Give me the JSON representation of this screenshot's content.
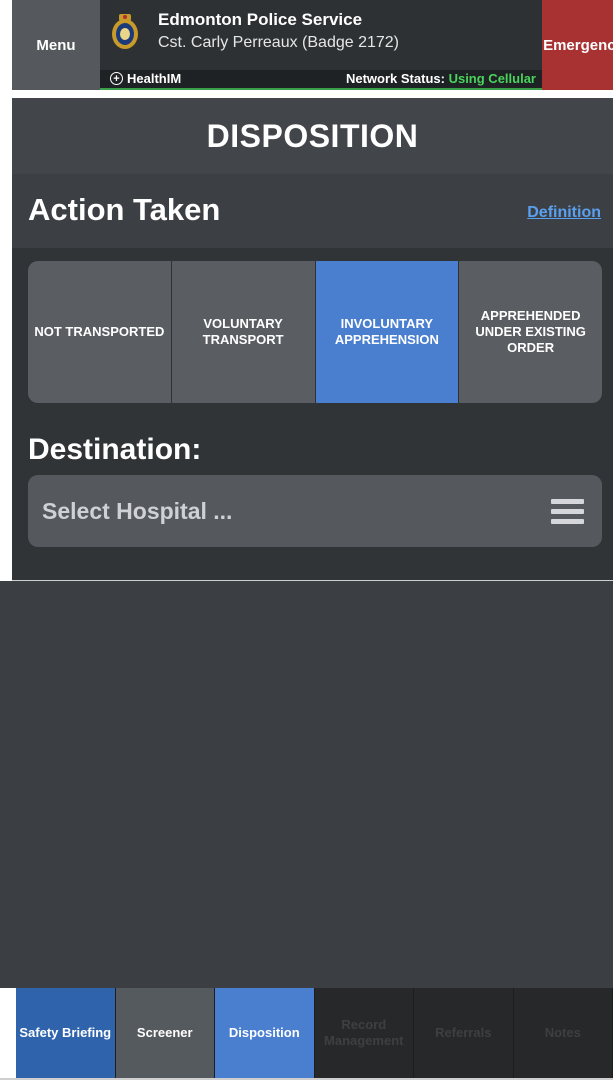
{
  "header": {
    "menu_label": "Menu",
    "agency_name": "Edmonton Police Service",
    "officer": "Cst. Carly Perreaux (Badge 2172)",
    "app_name": "HealthIM",
    "network_label": "Network Status:",
    "network_value": "Using Cellular",
    "emergency_label": "Emergency",
    "crest_icon": "police-crest-icon",
    "network_color": "#49d45b",
    "emergency_color": "#a83232"
  },
  "page": {
    "title": "DISPOSITION"
  },
  "action_section": {
    "title": "Action Taken",
    "definition_link": "Definition",
    "options": [
      {
        "label": "NOT TRANSPORTED",
        "selected": false
      },
      {
        "label": "VOLUNTARY TRANSPORT",
        "selected": false
      },
      {
        "label": "INVOLUNTARY APPREHENSION",
        "selected": true
      },
      {
        "label": "APPREHENDED UNDER EXISTING ORDER",
        "selected": false
      }
    ],
    "selected_color": "#4a7fd0"
  },
  "destination": {
    "label": "Destination:",
    "placeholder": "Select Hospital ...",
    "icon": "hamburger-menu-icon"
  },
  "tabs": [
    {
      "label": "Safety Briefing",
      "state": "completed"
    },
    {
      "label": "Screener",
      "state": "available"
    },
    {
      "label": "Disposition",
      "state": "selected"
    },
    {
      "label": "Record Management",
      "state": "disabled"
    },
    {
      "label": "Referrals",
      "state": "disabled"
    },
    {
      "label": "Notes",
      "state": "disabled"
    }
  ]
}
